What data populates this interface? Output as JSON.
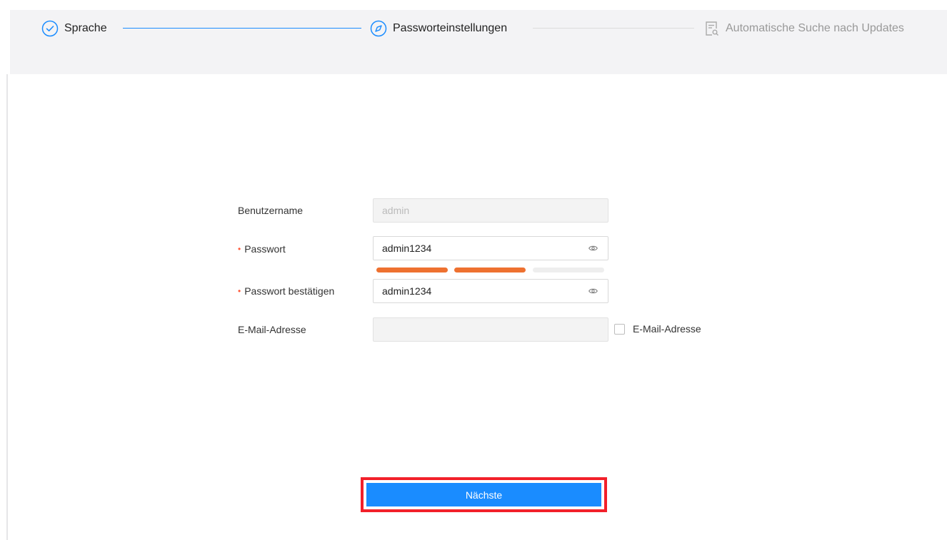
{
  "steps": [
    {
      "label": "Sprache",
      "icon": "check-circle-icon",
      "state": "done"
    },
    {
      "label": "Passworteinstellungen",
      "icon": "compass-icon",
      "state": "active"
    },
    {
      "label": "Automatische Suche nach Updates",
      "icon": "document-search-icon",
      "state": "pending"
    }
  ],
  "form": {
    "username": {
      "label": "Benutzername",
      "value": "admin"
    },
    "password": {
      "label": "Passwort",
      "value": "admin1234",
      "required_mark": "•"
    },
    "password_strength": {
      "filled_segments": 2,
      "total_segments": 3,
      "color": "#ee7130"
    },
    "confirm": {
      "label": "Passwort bestätigen",
      "value": "admin1234",
      "required_mark": "•"
    },
    "email": {
      "label": "E-Mail-Adresse",
      "value": "",
      "checkbox_label": "E-Mail-Adresse",
      "checked": false
    }
  },
  "buttons": {
    "next": "Nächste"
  },
  "colors": {
    "accent": "#1a8cff",
    "highlight_border": "#f2202a",
    "strength": "#ee7130"
  }
}
